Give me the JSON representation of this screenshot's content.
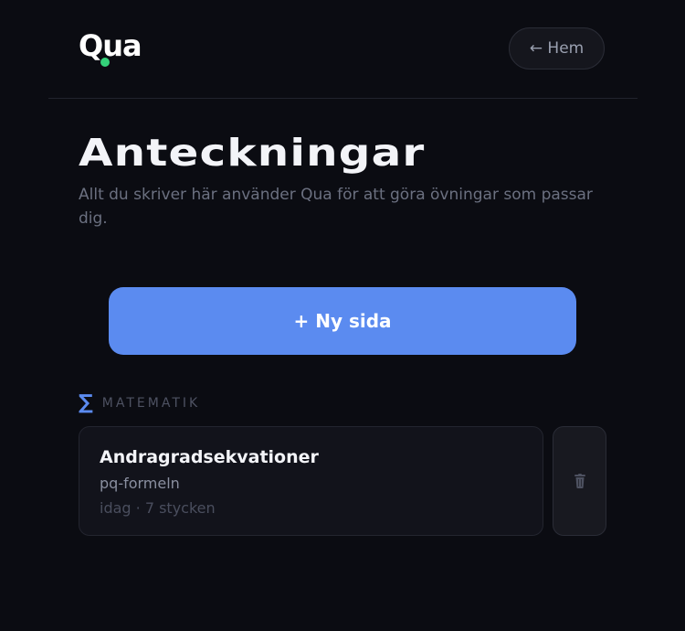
{
  "header": {
    "logo_text": "Qua",
    "home_label": "← Hem"
  },
  "page": {
    "title": "Anteckningar",
    "subtitle": "Allt du skriver här använder Qua för att göra övningar som passar dig.",
    "new_page_label": "+ Ny sida"
  },
  "sections": [
    {
      "icon": "sigma-icon",
      "label": "MATEMATIK",
      "notes": [
        {
          "title": "Andragradsekvationer",
          "subject": "pq-formeln",
          "meta": "idag · 7 stycken"
        }
      ]
    }
  ],
  "colors": {
    "background": "#0b0c12",
    "accent": "#5b8bf0",
    "logo_dot": "#34d27a",
    "card": "#12131b"
  }
}
